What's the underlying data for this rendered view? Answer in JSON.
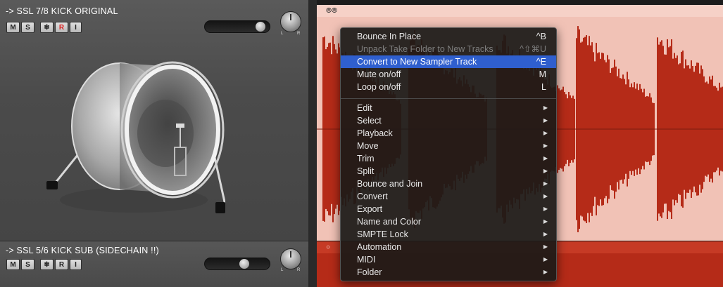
{
  "tracks": [
    {
      "name": "-> SSL 7/8 KICK ORIGINAL",
      "buttons": [
        "M",
        "S",
        "❄",
        "R",
        "I"
      ],
      "volume": 0.92
    },
    {
      "name": "-> SSL 5/6 KICK SUB (SIDECHAIN !!)",
      "buttons": [
        "M",
        "S",
        "❄",
        "R",
        "I"
      ],
      "volume": 0.62
    }
  ],
  "pan": {
    "left": "L",
    "right": "R"
  },
  "region_icons": [
    "loop-icon",
    "circle-icon"
  ],
  "context_menu": {
    "top_items": [
      {
        "label": "Bounce In Place",
        "shortcut": "^B"
      },
      {
        "label": "Unpack Take Folder to New Tracks",
        "shortcut": "^⇧⌘U",
        "disabled": true
      },
      {
        "label": "Convert to New Sampler Track",
        "shortcut": "^E",
        "highlighted": true
      },
      {
        "label": "Mute on/off",
        "shortcut": "M"
      },
      {
        "label": "Loop on/off",
        "shortcut": "L"
      }
    ],
    "submenus": [
      "Edit",
      "Select",
      "Playback",
      "Move",
      "Trim",
      "Split",
      "Bounce and Join",
      "Convert",
      "Export",
      "Name and Color",
      "SMPTE Lock",
      "Automation",
      "MIDI",
      "Folder"
    ],
    "submenu_arrow": "▶"
  },
  "colors": {
    "region_light": "#f1c2b6",
    "waveform": "#b52b18",
    "highlight": "#2f5fce"
  }
}
